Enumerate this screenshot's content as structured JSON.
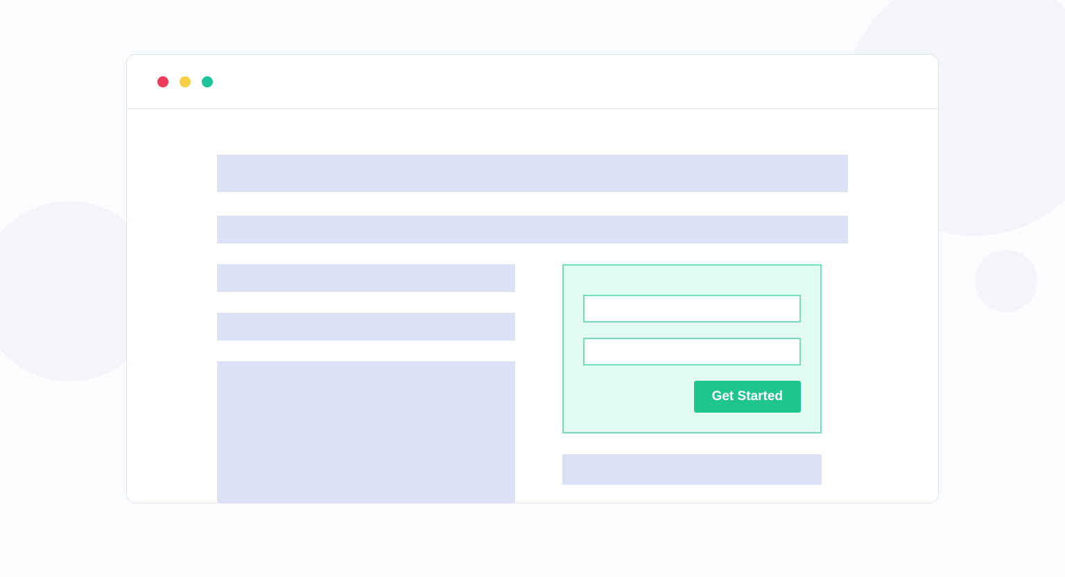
{
  "colors": {
    "window_dot_red": "#ED3B5B",
    "window_dot_yellow": "#F8CE46",
    "window_dot_green": "#1FC399",
    "placeholder_block": "#DCE2F5",
    "form_panel_bg": "#E3FCF1",
    "form_panel_border": "#73E0BA",
    "cta_button_bg": "#1FC58F",
    "cta_button_text": "#FFFFFF",
    "browser_border": "#DCE3F4",
    "page_background": "#FBFCFE"
  },
  "form": {
    "input1_value": "",
    "input2_value": "",
    "cta_label": "Get Started"
  }
}
